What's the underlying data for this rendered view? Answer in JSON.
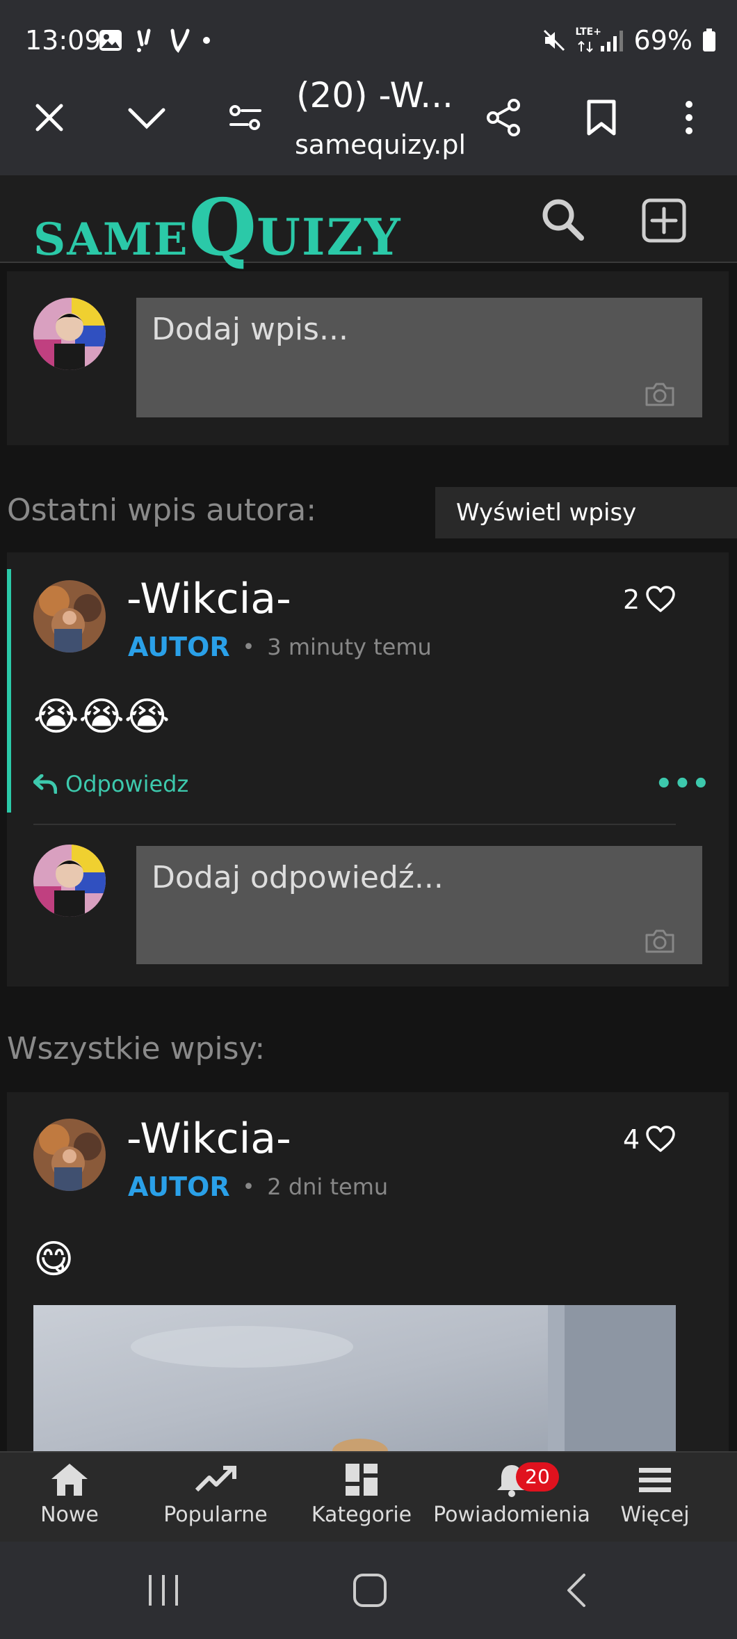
{
  "status_bar": {
    "time": "13:09",
    "network": "LTE+",
    "battery": "69%"
  },
  "browser": {
    "tab_title": "(20) -W...",
    "url": "samequizy.pl"
  },
  "site": {
    "logo_same": "SAME",
    "logo_q": "Q",
    "logo_uizy": "UIZY",
    "accent_color": "#2bc9a8"
  },
  "compose": {
    "placeholder": "Dodaj wpis..."
  },
  "latest_section": {
    "title": "Ostatni wpis autora:",
    "show_button": "Wyświetl wpisy autora"
  },
  "latest_post": {
    "author": "-Wikcia-",
    "badge": "AUTOR",
    "time": "3 minuty temu",
    "likes": "2",
    "content": "😭😭😭",
    "reply_label": "Odpowiedz",
    "more_label": "•••",
    "reply_placeholder": "Dodaj odpowiedź..."
  },
  "all_section": {
    "title": "Wszystkie wpisy:"
  },
  "post2": {
    "author": "-Wikcia-",
    "badge": "AUTOR",
    "time": "2 dni temu",
    "likes": "4",
    "content": "😋"
  },
  "bottom_nav": {
    "items": [
      {
        "label": "Nowe",
        "icon": "home-icon"
      },
      {
        "label": "Popularne",
        "icon": "trending-icon"
      },
      {
        "label": "Kategorie",
        "icon": "dashboard-icon"
      },
      {
        "label": "Powiadomienia",
        "icon": "bell-icon"
      },
      {
        "label": "Więcej",
        "icon": "menu-icon"
      }
    ],
    "notification_count": "20"
  }
}
